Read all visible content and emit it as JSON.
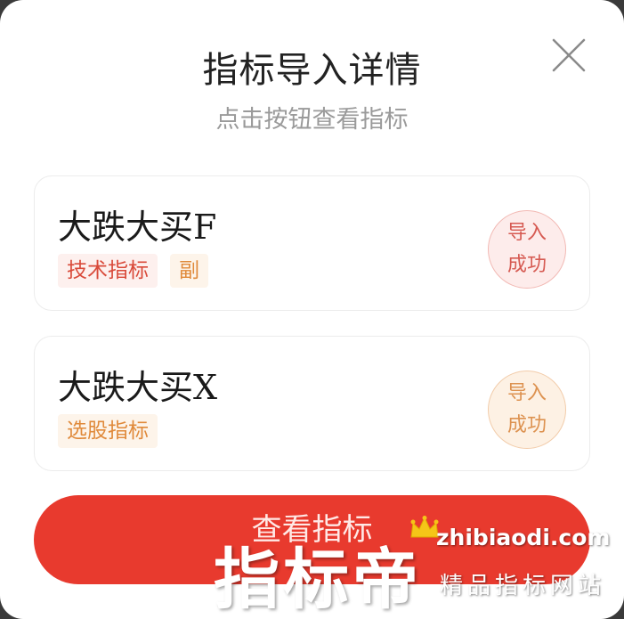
{
  "dialog": {
    "title": "指标导入详情",
    "subtitle": "点击按钮查看指标",
    "close_icon": "close-icon"
  },
  "indicators": [
    {
      "name": "大跌大买F",
      "tags": [
        "技术指标",
        "副"
      ],
      "status_line1": "导入",
      "status_line2": "成功",
      "status_color": "#d65a52"
    },
    {
      "name": "大跌大买X",
      "tags": [
        "选股指标"
      ],
      "status_line1": "导入",
      "status_line2": "成功",
      "status_color": "#dd9250"
    }
  ],
  "actions": {
    "view_label": "查看指标",
    "button_color": "#e83a2e"
  },
  "watermark": {
    "brand": "指标帝",
    "url": "zhibiaodi.com",
    "tagline": "精品指标网站",
    "icon": "crown-icon"
  }
}
